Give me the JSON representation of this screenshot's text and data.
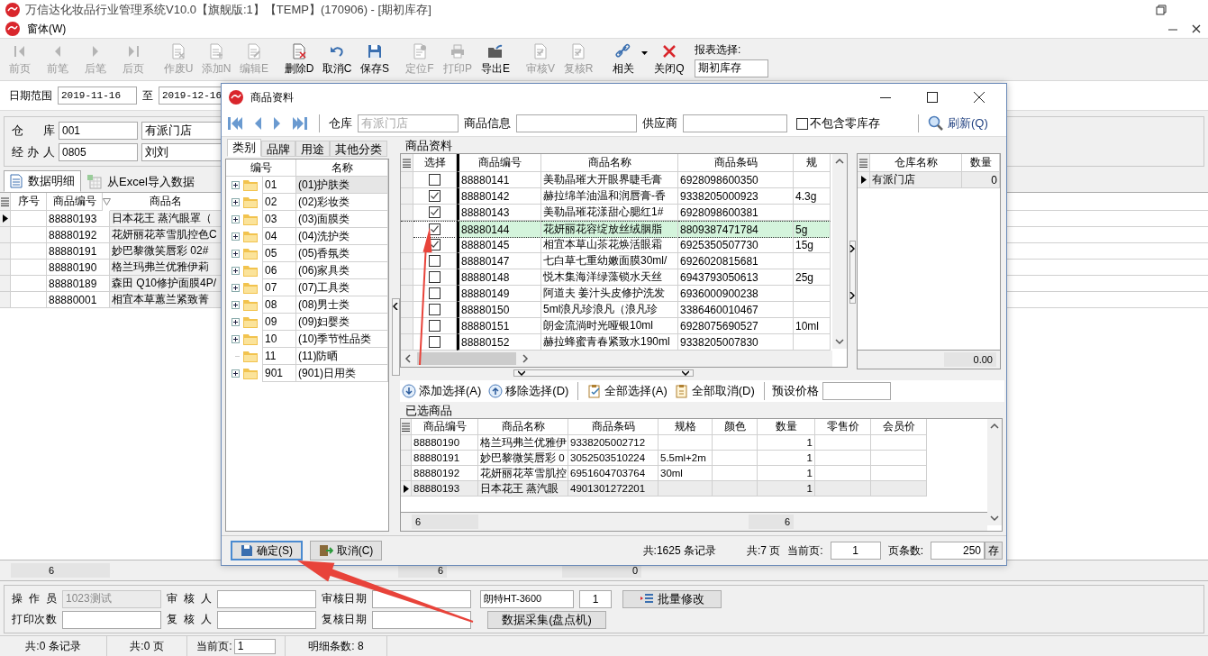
{
  "window": {
    "title": "万信达化妆品行业管理系统V10.0【旗舰版:1】【TEMP】(170906) - [期初库存]",
    "menu": [
      "窗体(W)"
    ]
  },
  "toolbar": [
    {
      "label": "前页",
      "kind": "first",
      "disabled": true
    },
    {
      "label": "前笔",
      "kind": "prev",
      "disabled": true
    },
    {
      "label": "后笔",
      "kind": "next",
      "disabled": true
    },
    {
      "label": "后页",
      "kind": "last",
      "disabled": true
    },
    {
      "label": "作废U",
      "kind": "void",
      "disabled": true
    },
    {
      "label": "添加N",
      "kind": "add",
      "disabled": true
    },
    {
      "label": "编辑E",
      "kind": "edit",
      "disabled": true
    },
    {
      "label": "删除D",
      "kind": "delete",
      "disabled": false
    },
    {
      "label": "取消C",
      "kind": "undo",
      "disabled": false
    },
    {
      "label": "保存S",
      "kind": "save",
      "disabled": false
    },
    {
      "label": "定位F",
      "kind": "locate",
      "disabled": true
    },
    {
      "label": "打印P",
      "kind": "print",
      "disabled": true
    },
    {
      "label": "导出E",
      "kind": "export",
      "disabled": false
    },
    {
      "label": "审核V",
      "kind": "audit",
      "disabled": true
    },
    {
      "label": "复核R",
      "kind": "audit",
      "disabled": true
    },
    {
      "label": "相关",
      "kind": "link",
      "disabled": false
    },
    {
      "label": "关闭Q",
      "kind": "close",
      "disabled": false
    }
  ],
  "report_select": {
    "label": "报表选择:",
    "value": "期初库存"
  },
  "date_range": {
    "label": "日期范围",
    "from": "2019-11-16",
    "to_label": "至",
    "to": "2019-12-16"
  },
  "header_fields": [
    {
      "label": "仓 库",
      "code": "001",
      "name": "有派门店"
    },
    {
      "label": "经 办 人",
      "code": "0805",
      "name": "刘刘"
    }
  ],
  "tabs": [
    {
      "label": "数据明细",
      "kind": "document",
      "selected": true
    },
    {
      "label": "从Excel导入数据",
      "kind": "sheet",
      "selected": false
    }
  ],
  "detail_table": {
    "columns": [
      "序号",
      "商品编号",
      "商品名"
    ],
    "rows": [
      {
        "current": true,
        "code": "88880193",
        "name": "日本花王 蒸汽眼罩（"
      },
      {
        "current": false,
        "code": "88880192",
        "name": "花妍丽花萃雪肌控色C"
      },
      {
        "current": false,
        "code": "88880191",
        "name": "妙巴黎微笑唇彩 02#"
      },
      {
        "current": false,
        "code": "88880190",
        "name": "格兰玛弗兰优雅伊莉"
      },
      {
        "current": false,
        "code": "88880189",
        "name": "森田 Q10修护面膜4P/"
      },
      {
        "current": false,
        "code": "88880001",
        "name": "相宜本草蕙兰紧致菁"
      }
    ],
    "totals": [
      "6",
      "6",
      "0"
    ]
  },
  "footer_form": {
    "rows": [
      {
        "fields": [
          {
            "label": "操 作 员",
            "value": "1023测试",
            "disabled": true
          },
          {
            "label": "审 核 人",
            "disabled": false
          },
          {
            "label": "审核日期",
            "disabled": false
          }
        ],
        "extra": [
          {
            "kind": "field",
            "value": "朗特HT-3600"
          },
          {
            "kind": "small-field",
            "value": "1"
          },
          {
            "kind": "button",
            "label": "批量修改"
          }
        ]
      },
      {
        "fields": [
          {
            "label": "打印次数",
            "disabled": false
          },
          {
            "label": "复 核 人",
            "disabled": false
          },
          {
            "label": "复核日期",
            "disabled": false
          }
        ],
        "extra": [
          {
            "kind": "wide-button",
            "label": "数据采集(盘点机)"
          }
        ]
      }
    ]
  },
  "status_bar": {
    "records": "共:0 条记录",
    "pages": "共:0 页",
    "current_label": "当前页:",
    "current": "1",
    "detail_count": "明细条数: 8"
  },
  "dialog": {
    "title": "商品资料",
    "filters": {
      "warehouse_label": "仓库",
      "warehouse": "有派门店",
      "info_label": "商品信息",
      "supplier_label": "供应商",
      "exclude_zero": {
        "label": "不包含零库存",
        "checked": false
      },
      "refresh": "刷新(Q)"
    },
    "category_tabs": [
      {
        "label": "类别",
        "selected": true
      },
      {
        "label": "品牌",
        "selected": false
      },
      {
        "label": "用途",
        "selected": false
      },
      {
        "label": "其他分类",
        "selected": false
      }
    ],
    "tree": {
      "columns": [
        "编号",
        "名称"
      ],
      "rows": [
        {
          "code": "01",
          "name": "(01)护肤类",
          "has_children": true,
          "selected": true
        },
        {
          "code": "02",
          "name": "(02)彩妆类",
          "has_children": true,
          "selected": false
        },
        {
          "code": "03",
          "name": "(03)面膜类",
          "has_children": true,
          "selected": false
        },
        {
          "code": "04",
          "name": "(04)洗护类",
          "has_children": true,
          "selected": false
        },
        {
          "code": "05",
          "name": "(05)香氛类",
          "has_children": true,
          "selected": false
        },
        {
          "code": "06",
          "name": "(06)家具类",
          "has_children": true,
          "selected": false
        },
        {
          "code": "07",
          "name": "(07)工具类",
          "has_children": true,
          "selected": false
        },
        {
          "code": "08",
          "name": "(08)男士类",
          "has_children": true,
          "selected": false
        },
        {
          "code": "09",
          "name": "(09)妇婴类",
          "has_children": true,
          "selected": false
        },
        {
          "code": "10",
          "name": "(10)季节性品类",
          "has_children": true,
          "selected": false
        },
        {
          "code": "11",
          "name": "(11)防晒",
          "has_children": false,
          "selected": false
        },
        {
          "code": "901",
          "name": "(901)日用类",
          "has_children": true,
          "selected": false
        }
      ]
    },
    "products": {
      "title": "商品资料",
      "columns": [
        "选择",
        "商品编号",
        "商品名称",
        "商品条码",
        "规"
      ],
      "rows": [
        {
          "checked": false,
          "current": false,
          "code": "88880141",
          "name": "美勒晶璀大开眼界睫毛膏",
          "barcode": "6928098600350"
        },
        {
          "checked": true,
          "current": false,
          "code": "88880142",
          "name": "赫拉绵羊油温和润唇膏-香",
          "barcode": "9338205000923",
          "spec": "4.3g"
        },
        {
          "checked": true,
          "current": false,
          "code": "88880143",
          "name": "美勒晶璀花漾甜心腮红1#",
          "barcode": "6928098600381"
        },
        {
          "checked": true,
          "current": true,
          "code": "88880144",
          "name": "花妍丽花容绽放丝绒胭脂",
          "barcode": "8809387471784",
          "spec": "5g"
        },
        {
          "checked": true,
          "current": false,
          "code": "88880145",
          "name": "相宜本草山茶花焕活眼霜",
          "barcode": "6925350507730",
          "spec": "15g"
        },
        {
          "checked": false,
          "current": false,
          "code": "88880147",
          "name": "七白草七重幼嫩面膜30ml/",
          "barcode": "6926020815681"
        },
        {
          "checked": false,
          "current": false,
          "code": "88880148",
          "name": "悦木集海洋绿藻锁水天丝",
          "barcode": "6943793050613",
          "spec": "25g"
        },
        {
          "checked": false,
          "current": false,
          "code": "88880149",
          "name": "阿道夫 姜汁头皮修护洗发",
          "barcode": "6936000900238"
        },
        {
          "checked": false,
          "current": false,
          "code": "88880150",
          "name": "5ml浪凡珍浪凡（浪凡珍",
          "barcode": "3386460010467"
        },
        {
          "checked": false,
          "current": false,
          "code": "88880151",
          "name": "朗金流淌时光哑银10ml",
          "barcode": "6928075690527",
          "spec": "10ml"
        },
        {
          "checked": false,
          "current": false,
          "code": "88880152",
          "name": "赫拉蜂蜜青春紧致水190ml",
          "barcode": "9338205007830"
        }
      ]
    },
    "stock": {
      "columns": [
        "仓库名称",
        "数量"
      ],
      "rows": [
        {
          "current": true,
          "name": "有派门店",
          "qty": "0"
        }
      ],
      "total": "0.00"
    },
    "actions": [
      {
        "label": "添加选择(A)",
        "kind": "down"
      },
      {
        "label": "移除选择(D)",
        "kind": "up"
      },
      {
        "label": "全部选择(A)",
        "kind": "select-all"
      },
      {
        "label": "全部取消(D)",
        "kind": "clear-all"
      }
    ],
    "preset_price_label": "预设价格",
    "selected": {
      "title": "已选商品",
      "columns": [
        "商品编号",
        "商品名称",
        "商品条码",
        "规格",
        "颜色",
        "数量",
        "零售价",
        "会员价"
      ],
      "rows": [
        {
          "current": false,
          "cells": [
            "88880190",
            "格兰玛弗兰优雅伊",
            "9338205002712",
            "",
            "",
            "1",
            "",
            ""
          ]
        },
        {
          "current": false,
          "cells": [
            "88880191",
            "妙巴黎微笑唇彩 0",
            "3052503510224",
            "5.5ml+2m",
            "",
            "1",
            "",
            ""
          ]
        },
        {
          "current": false,
          "cells": [
            "88880192",
            "花妍丽花萃雪肌控",
            "6951604703764",
            "30ml",
            "",
            "1",
            "",
            ""
          ]
        },
        {
          "current": true,
          "cells": [
            "88880193",
            "日本花王 蒸汽眼",
            "4901301272201",
            "",
            "",
            "1",
            "",
            ""
          ]
        }
      ],
      "totals": [
        "6",
        "6"
      ]
    },
    "buttons": [
      {
        "label": "确定(S)",
        "kind": "ok"
      },
      {
        "label": "取消(C)",
        "kind": "cancel"
      }
    ],
    "paging": {
      "records": "共:1625 条记录",
      "pages": "共:7 页",
      "current_label": "当前页:",
      "current": "1",
      "size_label": "页条数:",
      "size": "250",
      "store": "存"
    }
  }
}
